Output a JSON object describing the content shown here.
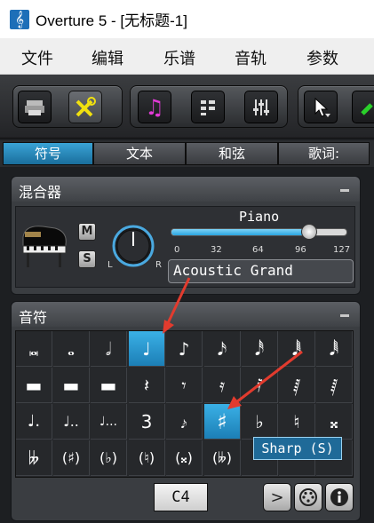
{
  "window": {
    "title": "Overture 5 - [无标题-1]"
  },
  "menubar": {
    "items": [
      "文件",
      "编辑",
      "乐谱",
      "音轨",
      "参数"
    ]
  },
  "tabs": [
    "符号",
    "文本",
    "和弦",
    "歌词:"
  ],
  "mixer": {
    "title": "混合器",
    "mute_label": "M",
    "solo_label": "S",
    "pan_left": "L",
    "pan_right": "R",
    "instrument_name": "Piano",
    "slider_ticks": [
      "0",
      "32",
      "64",
      "96",
      "127"
    ],
    "volume": 100,
    "patch": "Acoustic Grand"
  },
  "notes_panel": {
    "title": "音符",
    "rows": [
      [
        "𝅜",
        "𝅝",
        "𝅗𝅥",
        "♩",
        "♪",
        "𝅘𝅥𝅯",
        "𝅘𝅥𝅰",
        "𝅘𝅥𝅱"
      ],
      [
        "▬",
        "▬",
        "▬",
        "𝄽",
        "𝄾",
        "𝄿",
        "𝅀",
        "𝅁"
      ],
      [
        "♩.",
        "♩..",
        "♩...",
        "3",
        "𝆔",
        "♯",
        "♭",
        "♮",
        "𝄪"
      ],
      [
        "𝄫",
        "(♯)",
        "(♭)",
        "(♮)",
        "(𝄪)",
        "(𝄫)",
        "",
        "",
        ""
      ]
    ],
    "selected_note_index": 3,
    "selected_accidental_index": 5,
    "tooltip": "Sharp (S)",
    "pitch": "C4"
  },
  "colors": {
    "accent": "#2a9ad6",
    "arrow": "#e23b2e",
    "panel_bg": "#3a3d41"
  }
}
